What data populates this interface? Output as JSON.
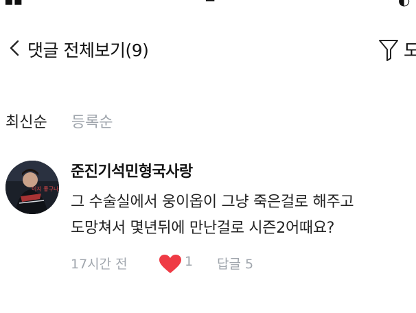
{
  "header": {
    "title": "댓글 전체보기(9)",
    "filter_label": "도"
  },
  "sort": {
    "options": [
      "최신순",
      "등록순"
    ],
    "selected": "최신순"
  },
  "comments": [
    {
      "author": "준진기석민형국사랑",
      "text_line1": "그 수술실에서 웅이옵이 그냥 죽은걸로 해주고",
      "text_line2": "도망쳐서 몇년뒤에 만난걸로 시즌2어때요?",
      "time": "17시간 전",
      "likes": "1",
      "reply_label": "답글 5",
      "avatar_caption": "이지 좋구나"
    }
  ],
  "colors": {
    "heart": "#ef3b45",
    "muted_text": "#a0a6ad",
    "text": "#111111"
  }
}
